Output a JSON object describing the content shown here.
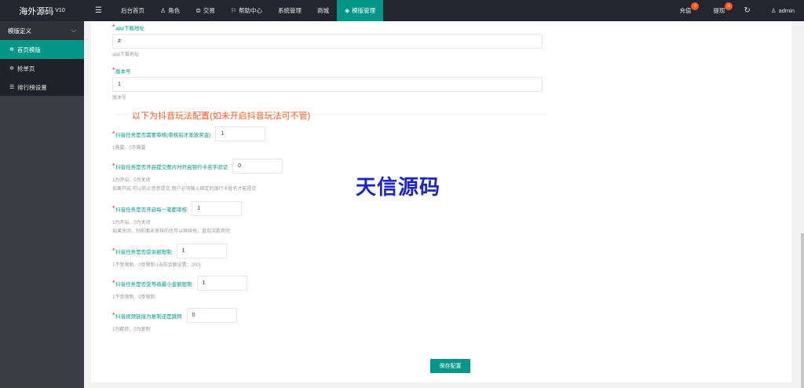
{
  "header": {
    "logo_text": "海外源码",
    "logo_version": "V10",
    "menu_icon": "menu-icon",
    "nav": [
      {
        "label": "后台首页",
        "icon": ""
      },
      {
        "label": "角色",
        "icon": "user-icon"
      },
      {
        "label": "交易",
        "icon": "trade-icon"
      },
      {
        "label": "帮助中心",
        "icon": "flag-icon"
      },
      {
        "label": "系统管理",
        "icon": ""
      },
      {
        "label": "商城",
        "icon": ""
      },
      {
        "label": "模版管理",
        "icon": "layers-icon"
      }
    ],
    "recharge_label": "充值",
    "recharge_badge": "0",
    "withdraw_label": "提现",
    "withdraw_badge": "0",
    "refresh_icon": "refresh-icon",
    "user_label": "admin",
    "accent": "#009688"
  },
  "sidebar": {
    "group_label": "模版定义",
    "items": [
      {
        "label": "首页模版",
        "icon": "gear-icon",
        "active": true
      },
      {
        "label": "抢单页",
        "icon": "gear-icon",
        "active": false
      },
      {
        "label": "排行榜设置",
        "icon": "list-icon",
        "active": false
      }
    ]
  },
  "form": {
    "app_download": {
      "label": "app下载地址",
      "value": "#",
      "hint": "app下载地址"
    },
    "version": {
      "label": "版本号",
      "value": "1",
      "hint": "版本号"
    },
    "section_title": "以下为抖音玩法配置(如未开启抖音玩法可不管)",
    "douyin_review": {
      "label": "抖音任务是否需要审核(审核后才发放奖金)",
      "value": "1",
      "hint": "1需要，0不需要"
    },
    "douyin_bankcard": {
      "label": "抖音任务是否开启提交图片时开启银行卡名字验证",
      "value": "0",
      "hint1": "1为开启，0为关闭",
      "hint2": "如果开启,可以防止恶意提交,用户必须输入绑定的银行卡姓名才能提交"
    },
    "douyin_one_review": {
      "label": "抖音任务是否开启每一笔都审核",
      "value": "1",
      "hint1": "1为开启，0为关闭",
      "hint2": "如果关闭，则前面未审核的也可以继续抢，直到次数用完"
    },
    "douyin_balance_limit": {
      "label": "抖音任务是否受余额限制",
      "value": "1",
      "hint": "1不受限制，0受限制-(当前余额设置：200)"
    },
    "douyin_level_limit": {
      "label": "抖音任务是否受等级最小金额限制",
      "value": "1",
      "hint": "1不受限制，0受限制"
    },
    "douyin_link": {
      "label": "抖音视频链接为复制还是跳转",
      "value": "0",
      "hint": "1为跳转，0为复制"
    },
    "save_label": "保存配置"
  },
  "watermark": "天信源码"
}
